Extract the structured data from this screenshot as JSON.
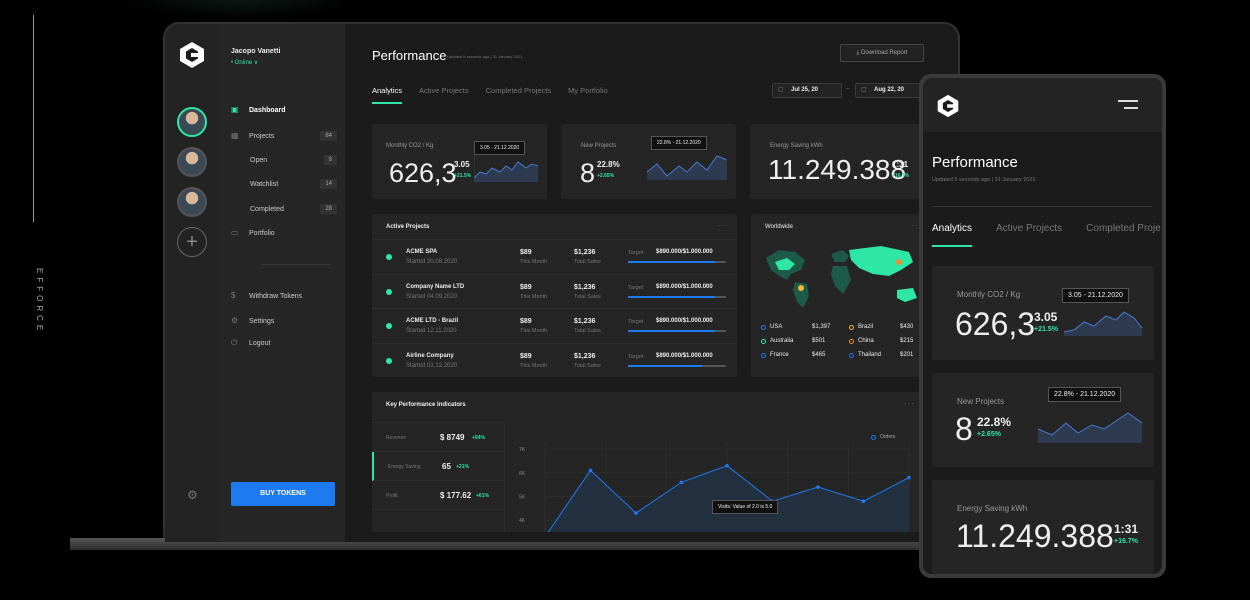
{
  "brand": {
    "vertical_text": "EFFORCE"
  },
  "user": {
    "name": "Jacopo Vanetti",
    "status": "• Online  ∨"
  },
  "sidebar": {
    "items": [
      {
        "label": "Dashboard",
        "icon": "grid-icon"
      },
      {
        "label": "Projects",
        "count": "84",
        "icon": "apps-icon"
      },
      {
        "label": "Open",
        "count": "8"
      },
      {
        "label": "Watchlist",
        "count": "14"
      },
      {
        "label": "Completed",
        "count": "28"
      },
      {
        "label": "Portfolio",
        "icon": "briefcase-icon"
      },
      {
        "label": "Withdraw Tokens",
        "icon": "dollar-icon"
      },
      {
        "label": "Settings",
        "icon": "gear-icon"
      },
      {
        "label": "Logout",
        "icon": "power-icon"
      }
    ],
    "buy_button": "BUY TOKENS"
  },
  "header": {
    "title": "Performance",
    "subtitle": "Updated 5 seconds ago  |  31 January 2021",
    "download": "Download Report",
    "tabs": [
      "Analytics",
      "Active Projects",
      "Completed Projects",
      "My Portfolio"
    ],
    "date_from": "Jul 25, 20",
    "date_sep": "–",
    "date_to": "Aug 22, 20"
  },
  "stats": [
    {
      "title": "Monthly CO2 / Kg",
      "value": "626,3",
      "sub": "3.05",
      "pct": "+21.5%",
      "tooltip": "3.05 - 21.12.2020"
    },
    {
      "title": "New Projects",
      "value": "8",
      "sub": "22.8%",
      "pct": "+2.65%",
      "tooltip": "22.8% - 21.12.2020"
    },
    {
      "title": "Energy Saving kWh",
      "value": "11.249.388",
      "sub": "1:31",
      "pct": "+16.7%"
    }
  ],
  "active_projects": {
    "title": "Active Projects",
    "more": "···",
    "rows": [
      {
        "name": "ACME SPA",
        "started": "Started  20.08.2020",
        "v1": "$89",
        "v1s": "This Month",
        "v2": "$1,236",
        "v2s": "Total Sales",
        "target_label": "Target",
        "target": "$890.000/$1.000.000",
        "progress": 0.89
      },
      {
        "name": "Company Name LTD",
        "started": "Started  04.09.2020",
        "v1": "$89",
        "v1s": "This Month",
        "v2": "$1,236",
        "v2s": "Total Sales",
        "target_label": "Target",
        "target": "$890.000/$1.000.000",
        "progress": 0.89
      },
      {
        "name": "ACME LTD - Brazil",
        "started": "Started  12.11.2020",
        "v1": "$89",
        "v1s": "This Month",
        "v2": "$1,236",
        "v2s": "Total Sales",
        "target_label": "Target",
        "target": "$890.000/$1.000.000",
        "progress": 0.89
      },
      {
        "name": "Airline Company",
        "started": "Started  01.12.2020",
        "v1": "$89",
        "v1s": "This Month",
        "v2": "$1,236",
        "v2s": "Total Sales",
        "target_label": "Target",
        "target": "$890.000/$1.000.000",
        "progress": 0.76
      }
    ]
  },
  "worldwide": {
    "title": "Worldwide",
    "more": "···",
    "legend": [
      {
        "country": "USA",
        "value": "$1,397",
        "color": "#1e7af0"
      },
      {
        "country": "Brazil",
        "value": "$430",
        "color": "#f5b82e"
      },
      {
        "country": "Australia",
        "value": "$501",
        "color": "#2ee6a6"
      },
      {
        "country": "China",
        "value": "$215",
        "color": "#f58a2e"
      },
      {
        "country": "France",
        "value": "$465",
        "color": "#1e7af0"
      },
      {
        "country": "Thailand",
        "value": "$201",
        "color": "#1e7af0"
      }
    ]
  },
  "kpi": {
    "title": "Key Performance Indicators",
    "more": "···",
    "rows": [
      {
        "label": "Revenue",
        "value": "$ 8749",
        "pct": "+54%"
      },
      {
        "label": "Energy Saving",
        "value": "65",
        "pct": "+21%"
      },
      {
        "label": "Profit",
        "value": "$ 177.62",
        "pct": "+61%"
      }
    ],
    "legend": "Orders",
    "tooltip": "Visits: Value of 2.0 is 5.0"
  },
  "chart_data": {
    "type": "line",
    "series": [
      {
        "name": "Orders",
        "values": [
          3.3,
          6.1,
          4.3,
          5.6,
          6.3,
          4.8,
          5.4,
          4.8,
          5.8
        ]
      }
    ],
    "x": [
      0,
      1,
      2,
      3,
      4,
      5,
      6,
      7,
      8
    ],
    "ytick_labels": [
      "7K",
      "6K",
      "5K",
      "4K"
    ],
    "ylim": [
      3.5,
      7.3
    ],
    "grid": true
  },
  "mobile": {
    "title": "Performance",
    "subtitle": "Updated 5 seconds ago  |  31 January 2021",
    "tabs": [
      "Analytics",
      "Active Projects",
      "Completed Proje"
    ],
    "stats": [
      {
        "title": "Monthly CO2 / Kg",
        "value": "626,3",
        "sub": "3.05",
        "pct": "+21.5%",
        "tooltip": "3.05 - 21.12.2020"
      },
      {
        "title": "New Projects",
        "value": "8",
        "sub": "22.8%",
        "pct": "+2.65%",
        "tooltip": "22.8% - 21.12.2020"
      },
      {
        "title": "Energy Saving kWh",
        "value": "11.249.388",
        "sub": "1:31",
        "pct": "+16.7%"
      }
    ]
  },
  "colors": {
    "accent": "#2ee6a6",
    "primary": "#1e7af0",
    "bg": "#1b1b1b",
    "card": "#252525"
  }
}
